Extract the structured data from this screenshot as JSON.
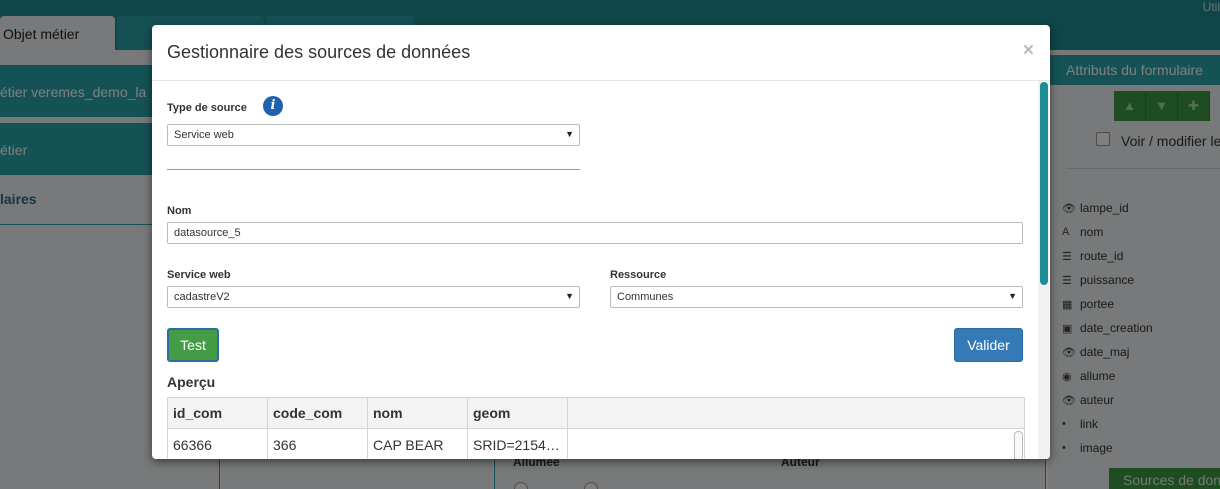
{
  "app": {
    "user_label": "Util",
    "tabs": [
      {
        "label": "Objet métier"
      },
      {
        "label": ""
      },
      {
        "label": ""
      }
    ],
    "left_panel": {
      "items": [
        {
          "label": "étier veremes_demo_la"
        },
        {
          "label": "étier"
        },
        {
          "label": "laires"
        }
      ]
    },
    "middle_panel": {
      "label_allumee": "Allumée",
      "label_auteur": "Auteur"
    },
    "right_panel": {
      "header": "Attributs du formulaire",
      "toolbar_icons": [
        "arrow-up-icon",
        "arrow-down-icon",
        "plus-icon"
      ],
      "toolbar_glyphs": [
        "▲",
        "▼",
        "✚"
      ],
      "checkbox_label": "Voir / modifier le",
      "attributes": [
        {
          "label": "lampe_id",
          "icon": "eye-icon",
          "glyph": "👁"
        },
        {
          "label": "nom",
          "icon": "text-icon",
          "glyph": "A"
        },
        {
          "label": "route_id",
          "icon": "list-icon",
          "glyph": "☰"
        },
        {
          "label": "puissance",
          "icon": "list-icon",
          "glyph": "☰"
        },
        {
          "label": "portee",
          "icon": "calculator-icon",
          "glyph": "▦"
        },
        {
          "label": "date_creation",
          "icon": "calendar-icon",
          "glyph": "▣"
        },
        {
          "label": "date_maj",
          "icon": "eye-icon",
          "glyph": "👁"
        },
        {
          "label": "allume",
          "icon": "radio-icon",
          "glyph": "◉"
        },
        {
          "label": "auteur",
          "icon": "eye-icon",
          "glyph": "👁"
        },
        {
          "label": "link",
          "icon": "dot-icon",
          "glyph": "•"
        },
        {
          "label": "image",
          "icon": "dot-icon",
          "glyph": "•"
        }
      ],
      "bottom_button": "Sources de donn"
    }
  },
  "modal": {
    "title": "Gestionnaire des sources de données",
    "close_glyph": "×",
    "type_source": {
      "label": "Type de source",
      "info_glyph": "i",
      "value": "Service web",
      "arrow": "▼"
    },
    "nom": {
      "label": "Nom",
      "value": "datasource_5"
    },
    "service_web": {
      "label": "Service web",
      "value": "cadastreV2",
      "arrow": "▼"
    },
    "ressource": {
      "label": "Ressource",
      "value": "Communes",
      "arrow": "▼"
    },
    "test_button": "Test",
    "valider_button": "Valider",
    "apercu": {
      "title": "Aperçu",
      "columns": [
        "id_com",
        "code_com",
        "nom",
        "geom"
      ],
      "rows": [
        [
          "66366",
          "366",
          "CAP BEAR",
          "SRID=2154…"
        ]
      ]
    }
  }
}
